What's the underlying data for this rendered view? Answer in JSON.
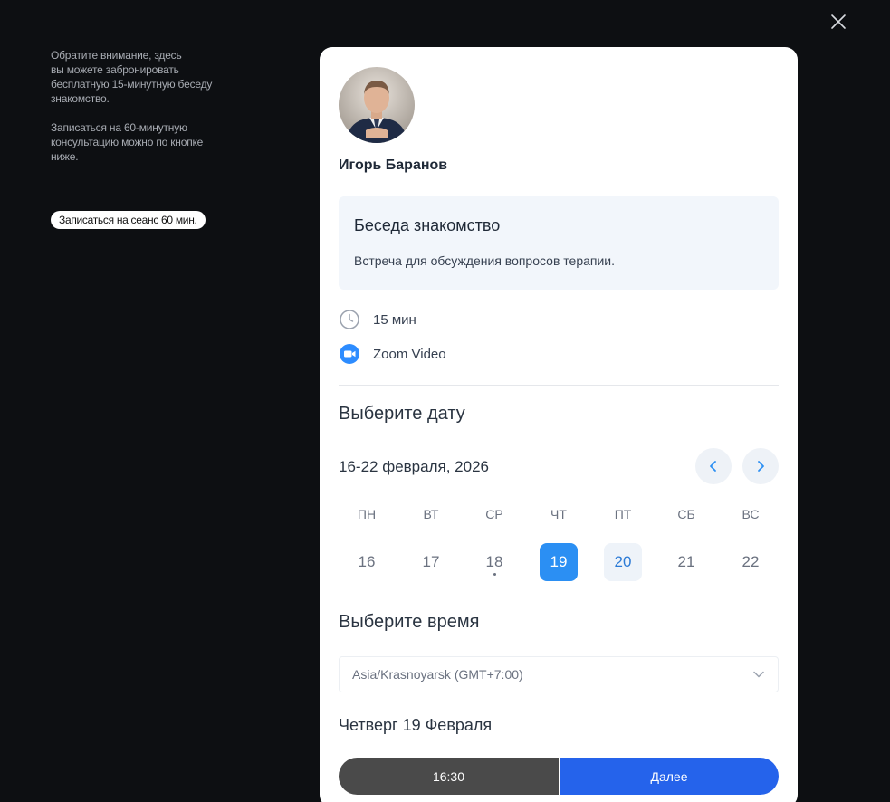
{
  "side_note": {
    "paragraph1": "Обратите внимание, здесь\nвы можете забронировать\nбесплатную 15-минутную беседу\nзнакомство.",
    "paragraph2": "Записаться на 60-минутную\nконсультацию можно по кнопке\nниже.",
    "button_label": "Записаться на сеанс 60 мин."
  },
  "close_icon": "close-icon",
  "host": {
    "name": "Игорь Баранов"
  },
  "event": {
    "title": "Беседа знакомство",
    "description": "Встреча для обсуждения вопросов терапии.",
    "duration": "15 мин",
    "location": "Zoom Video"
  },
  "date_picker": {
    "title": "Выберите дату",
    "week_range": "16-22 февраля, 2026",
    "days": [
      {
        "dow": "ПН",
        "date": "16",
        "state": "disabled"
      },
      {
        "dow": "ВТ",
        "date": "17",
        "state": "disabled"
      },
      {
        "dow": "СР",
        "date": "18",
        "state": "today"
      },
      {
        "dow": "ЧТ",
        "date": "19",
        "state": "selected"
      },
      {
        "dow": "ПТ",
        "date": "20",
        "state": "available"
      },
      {
        "dow": "СБ",
        "date": "21",
        "state": "disabled"
      },
      {
        "dow": "ВС",
        "date": "22",
        "state": "disabled"
      }
    ]
  },
  "time_picker": {
    "title": "Выберите время",
    "timezone": "Asia/Krasnoyarsk (GMT+7:00)",
    "selected_day": "Четверг 19 Февраля"
  },
  "footer": {
    "selected_time": "16:30",
    "next_label": "Далее"
  },
  "colors": {
    "accent": "#2b8ff3",
    "primary_button": "#2563eb",
    "time_button": "#4a4a4a",
    "background": "#0d0f12"
  }
}
